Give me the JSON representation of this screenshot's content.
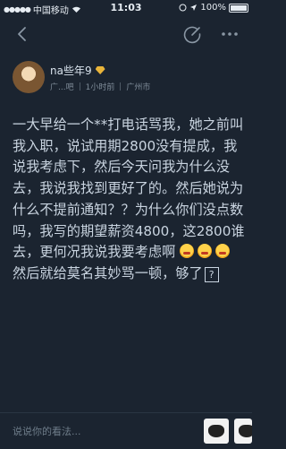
{
  "status_bar": {
    "carrier": "中国移动",
    "time": "11:03",
    "battery": "100%"
  },
  "author": {
    "name": "na些年9",
    "forum": "广...吧",
    "time_ago": "1小时前",
    "location": "广州市"
  },
  "post": {
    "text": "一大早给一个**打电话骂我，她之前叫我入职，说试用期2800没有提成，我说我考虑下，然后今天问我为什么没去，我说我找到更好了的。然后她说为什么不提前通知？？为什么你们没点数吗，我写的期望薪资4800，这2800谁去，更何况我说我要考虑啊",
    "text_end": "然后就给莫名其妙骂一顿，够了",
    "qmark": "?"
  },
  "bottom_bar": {
    "comment_placeholder": "说说你的看法..."
  },
  "colors": {
    "background": "#1b2430",
    "text": "#c9d4e0",
    "muted": "#7f8c99",
    "badge": "#e9b43a"
  },
  "icons": [
    "back-icon",
    "edit-icon",
    "more-icon",
    "wifi-icon",
    "location-icon",
    "alarm-icon",
    "battery-icon",
    "badge-icon",
    "emoji-icon",
    "sticker-icon"
  ]
}
